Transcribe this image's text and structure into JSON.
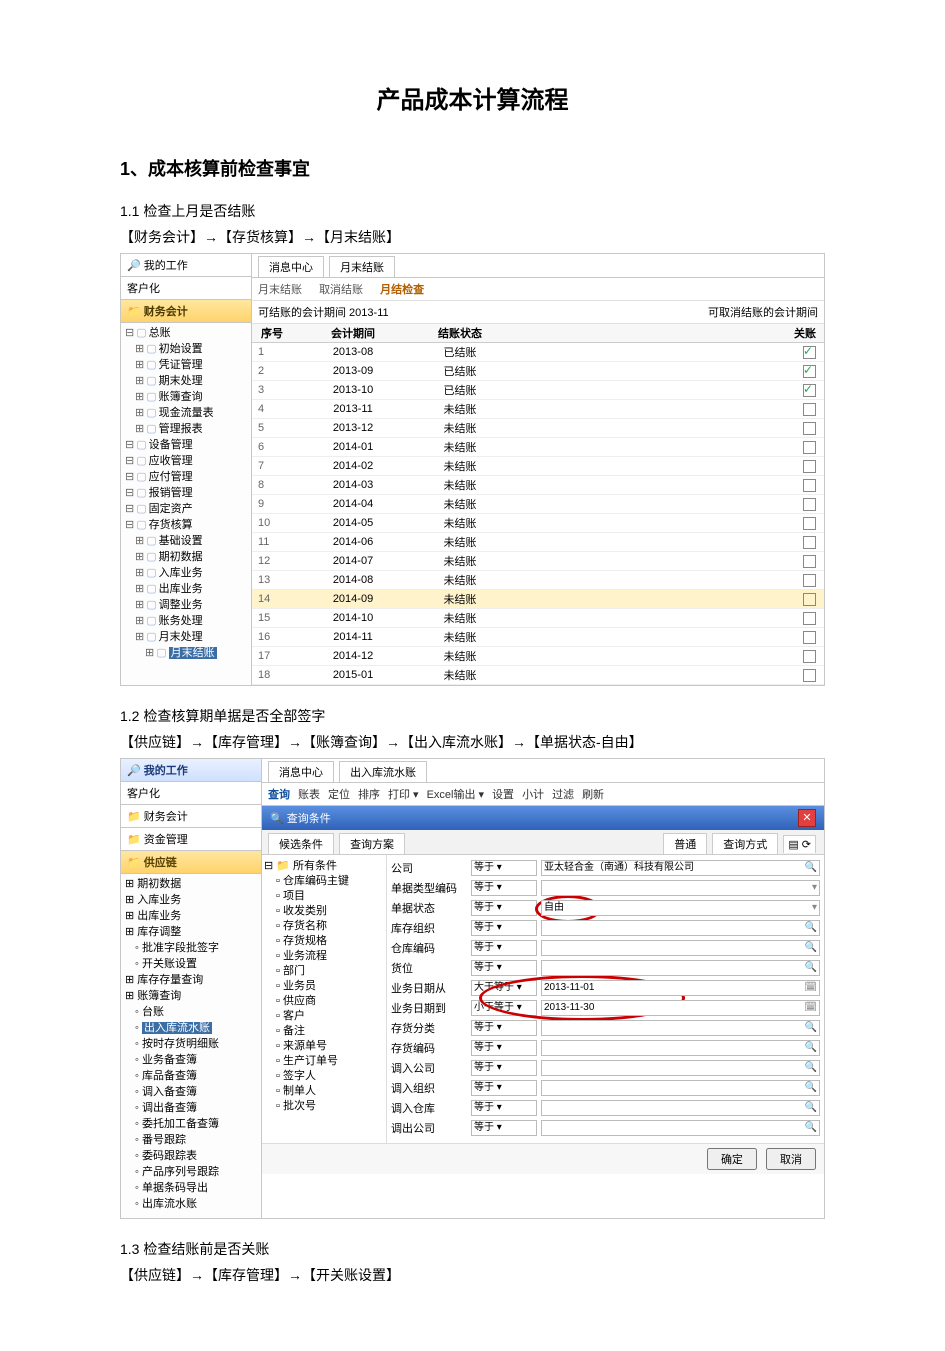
{
  "doc": {
    "title": "产品成本计算流程",
    "section1": "1、成本核算前检查事宜",
    "s1_1": "1.1 检查上月是否结账",
    "path1": "【财务会计】→【存货核算】→【月末结账】",
    "s1_2": "1.2 检查核算期单据是否全部签字",
    "path2": "【供应链】→【库存管理】→【账簿查询】→【出入库流水账】→【单据状态-自由】",
    "s1_3": "1.3 检查结账前是否关账",
    "path3": "【供应链】→【库存管理】→【开关账设置】"
  },
  "shot1": {
    "myjob": "我的工作",
    "khh": "客户化",
    "cwkj": "财务会计",
    "tabs": {
      "msg": "消息中心",
      "active": "月末结账"
    },
    "subtabs": {
      "a": "月末结账",
      "b": "取消结账",
      "c": "月结检查"
    },
    "period_label": "可结账的会计期间  2013-11",
    "right_label": "可取消结账的会计期间",
    "cols": {
      "seq": "序号",
      "period": "会计期间",
      "status": "结账状态",
      "close": "关账"
    },
    "rows": [
      {
        "seq": "1",
        "per": "2013-08",
        "stat": "已结账",
        "chk": true
      },
      {
        "seq": "2",
        "per": "2013-09",
        "stat": "已结账",
        "chk": true
      },
      {
        "seq": "3",
        "per": "2013-10",
        "stat": "已结账",
        "chk": true
      },
      {
        "seq": "4",
        "per": "2013-11",
        "stat": "未结账",
        "chk": false
      },
      {
        "seq": "5",
        "per": "2013-12",
        "stat": "未结账",
        "chk": false
      },
      {
        "seq": "6",
        "per": "2014-01",
        "stat": "未结账",
        "chk": false
      },
      {
        "seq": "7",
        "per": "2014-02",
        "stat": "未结账",
        "chk": false
      },
      {
        "seq": "8",
        "per": "2014-03",
        "stat": "未结账",
        "chk": false
      },
      {
        "seq": "9",
        "per": "2014-04",
        "stat": "未结账",
        "chk": false
      },
      {
        "seq": "10",
        "per": "2014-05",
        "stat": "未结账",
        "chk": false
      },
      {
        "seq": "11",
        "per": "2014-06",
        "stat": "未结账",
        "chk": false
      },
      {
        "seq": "12",
        "per": "2014-07",
        "stat": "未结账",
        "chk": false
      },
      {
        "seq": "13",
        "per": "2014-08",
        "stat": "未结账",
        "chk": false
      },
      {
        "seq": "14",
        "per": "2014-09",
        "stat": "未结账",
        "chk": false,
        "hl": true
      },
      {
        "seq": "15",
        "per": "2014-10",
        "stat": "未结账",
        "chk": false
      },
      {
        "seq": "16",
        "per": "2014-11",
        "stat": "未结账",
        "chk": false
      },
      {
        "seq": "17",
        "per": "2014-12",
        "stat": "未结账",
        "chk": false
      },
      {
        "seq": "18",
        "per": "2015-01",
        "stat": "未结账",
        "chk": false
      }
    ],
    "tree": [
      "总账",
      "  初始设置",
      "  凭证管理",
      "  期末处理",
      "  账簿查询",
      "  现金流量表",
      "  管理报表",
      "设备管理",
      "应收管理",
      "应付管理",
      "报销管理",
      "固定资产",
      "存货核算",
      "  基础设置",
      "  期初数据",
      "  入库业务",
      "  出库业务",
      "  调整业务",
      "  账务处理",
      "  月末处理",
      "    月末结账"
    ],
    "tree_selected": "月末结账"
  },
  "shot2": {
    "myjob": "我的工作",
    "khh": "客户化",
    "p_cwkj": "财务会计",
    "p_zjgl": "资金管理",
    "p_gyl": "供应链",
    "tabs": {
      "msg": "消息中心",
      "active": "出入库流水账"
    },
    "toolbar": [
      "查询",
      "账表",
      "定位",
      "排序",
      "打印 ▾",
      "Excel输出 ▾",
      "设置",
      "小计",
      "过滤",
      "刷新"
    ],
    "searchbar": "查询条件",
    "left_tabs": {
      "a": "候选条件",
      "b": "查询方案"
    },
    "right_tabs": {
      "a": "普通",
      "b": "查询方式"
    },
    "tree": [
      "所有条件",
      "  仓库编码主键",
      "  项目",
      "  收发类别",
      "  存货名称",
      "  存货规格",
      "  业务流程",
      "  部门",
      "  业务员",
      "  供应商",
      "  客户",
      "  备注",
      "  来源单号",
      "  生产订单号",
      "  签字人",
      "  制单人",
      "  批次号"
    ],
    "rows": [
      {
        "lbl": "公司",
        "op": "等于",
        "val": "亚太轻合金（南通）科技有限公司",
        "icon": "mag"
      },
      {
        "lbl": "单据类型编码",
        "op": "等于",
        "val": ""
      },
      {
        "lbl": "单据状态",
        "op": "等于",
        "val": "自由",
        "circle": 1
      },
      {
        "lbl": "库存组织",
        "op": "等于",
        "val": "",
        "icon": "mag"
      },
      {
        "lbl": "仓库编码",
        "op": "等于",
        "val": "",
        "icon": "mag"
      },
      {
        "lbl": "货位",
        "op": "等于",
        "val": "",
        "icon": "mag"
      },
      {
        "lbl": "业务日期从",
        "op": "大于等于",
        "val": "2013-11-01",
        "icon": "cal",
        "circle": 2
      },
      {
        "lbl": "业务日期到",
        "op": "小于等于",
        "val": "2013-11-30",
        "icon": "cal",
        "circle": 2
      },
      {
        "lbl": "存货分类",
        "op": "等于",
        "val": "",
        "icon": "mag"
      },
      {
        "lbl": "存货编码",
        "op": "等于",
        "val": "",
        "icon": "mag"
      },
      {
        "lbl": "调入公司",
        "op": "等于",
        "val": "",
        "icon": "mag"
      },
      {
        "lbl": "调入组织",
        "op": "等于",
        "val": "",
        "icon": "mag"
      },
      {
        "lbl": "调入仓库",
        "op": "等于",
        "val": "",
        "icon": "mag"
      },
      {
        "lbl": "调出公司",
        "op": "等于",
        "val": "",
        "icon": "mag"
      }
    ],
    "buttons": {
      "ok": "确定",
      "cancel": "取消"
    },
    "left_tree": [
      "期初数据",
      "入库业务",
      "出库业务",
      "库存调整",
      "  批准字段批签字",
      "  开关账设置",
      "库存存量查询",
      "账簿查询",
      "  台账",
      "  出入库流水账",
      "  按时存货明细账",
      "  业务备查簿",
      "  库品备查簿",
      "  调入备查簿",
      "  调出备查簿",
      "  委托加工备查簿",
      "  番号跟踪",
      "  委码跟踪表",
      "  产品序列号跟踪",
      "  单据条码导出",
      "  出库流水账"
    ],
    "left_tree_selected": "出入库流水账"
  }
}
